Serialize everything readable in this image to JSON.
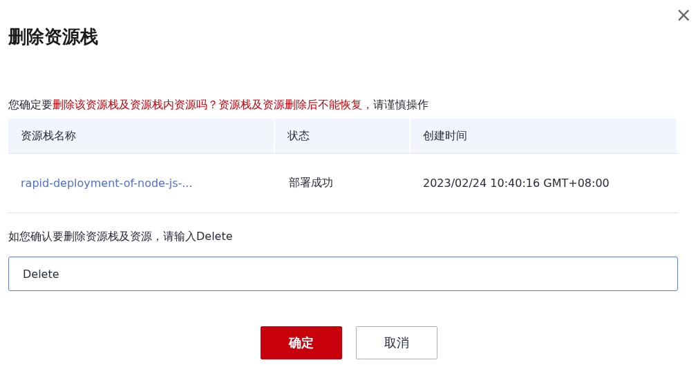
{
  "dialog": {
    "title": "删除资源栈",
    "close": "×"
  },
  "warning": {
    "prefix": "您确定要",
    "emphasis": "删除该资源栈及资源栈内资源吗？资源栈及资源删除后不能恢复，",
    "suffix": "请谨慎操作"
  },
  "table": {
    "columns": [
      "资源栈名称",
      "状态",
      "创建时间"
    ],
    "rows": [
      {
        "name": "rapid-deployment-of-node-js-...",
        "status": "部署成功",
        "created": "2023/02/24 10:40:16 GMT+08:00"
      }
    ]
  },
  "confirm": {
    "label": "如您确认要删除资源栈及资源，请输入Delete",
    "value": "Delete"
  },
  "buttons": [
    {
      "label": "确定",
      "kind": "primary"
    },
    {
      "label": "取消",
      "kind": "secondary"
    }
  ]
}
